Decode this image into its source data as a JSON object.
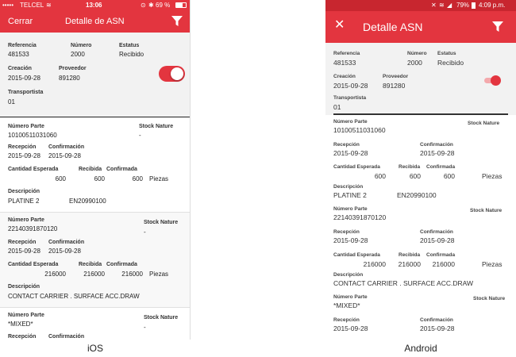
{
  "ios": {
    "status": {
      "carrier": "TELCEL",
      "time": "13:06",
      "battery": "69 %"
    },
    "nav": {
      "back": "Cerrar",
      "title": "Detalle de ASN"
    },
    "header": {
      "referencia_label": "Referencia",
      "referencia": "481533",
      "numero_label": "Número",
      "numero": "2000",
      "estatus_label": "Estatus",
      "estatus": "Recibido",
      "creacion_label": "Creación",
      "creacion": "2015-09-28",
      "proveedor_label": "Proveedor",
      "proveedor": "891280",
      "transportista_label": "Transportista",
      "transportista": "01"
    },
    "items": [
      {
        "np_label": "Número Parte",
        "np": "10100511031060",
        "sn_label": "Stock Nature",
        "sn": "-",
        "rec_label": "Recepción",
        "rec": "2015-09-28",
        "conf_label": "Confirmación",
        "conf": "2015-09-28",
        "ce_label": "Cantidad Esperada",
        "ce": "600",
        "rcb_label": "Recibida",
        "rcb": "600",
        "cf_label": "Confirmada",
        "cf": "600",
        "unit": "Piezas",
        "desc_label": "Descripción",
        "desc": "PLATINE 2",
        "desc2": "EN20990100"
      },
      {
        "np_label": "Número Parte",
        "np": "22140391870120",
        "sn_label": "Stock Nature",
        "sn": "-",
        "rec_label": "Recepción",
        "rec": "2015-09-28",
        "conf_label": "Confirmación",
        "conf": "2015-09-28",
        "ce_label": "Cantidad Esperada",
        "ce": "216000",
        "rcb_label": "Recibida",
        "rcb": "216000",
        "cf_label": "Confirmada",
        "cf": "216000",
        "unit": "Piezas",
        "desc_label": "Descripción",
        "desc": "CONTACT CARRIER . SURFACE ACC.DRAW"
      },
      {
        "np_label": "Número Parte",
        "np": "*MIXED*",
        "sn_label": "Stock Nature",
        "sn": "-",
        "rec_label": "Recepción",
        "conf_label": "Confirmación"
      }
    ],
    "caption": "iOS"
  },
  "android": {
    "status": {
      "battery": "79%",
      "time": "4:09 p.m."
    },
    "nav": {
      "title": "Detalle ASN"
    },
    "header": {
      "referencia_label": "Referencia",
      "referencia": "481533",
      "numero_label": "Número",
      "numero": "2000",
      "estatus_label": "Estatus",
      "estatus": "Recibido",
      "creacion_label": "Creación",
      "creacion": "2015-09-28",
      "proveedor_label": "Proveedor",
      "proveedor": "891280",
      "transportista_label": "Transportista",
      "transportista": "01"
    },
    "items": [
      {
        "np_label": "Número Parte",
        "np": "10100511031060",
        "sn_label": "Stock Nature",
        "rec_label": "Recepción",
        "rec": "2015-09-28",
        "conf_label": "Confirmación",
        "conf": "2015-09-28",
        "ce_label": "Cantidad Esperada",
        "ce": "600",
        "rcb_label": "Recibida",
        "rcb": "600",
        "cf_label": "Confirmada",
        "cf": "600",
        "unit": "Piezas",
        "desc_label": "Descripción",
        "desc": "PLATINE 2",
        "desc2": "EN20990100"
      },
      {
        "np_label": "Número Parte",
        "np": "22140391870120",
        "sn_label": "Stock Nature",
        "rec_label": "Recepción",
        "rec": "2015-09-28",
        "conf_label": "Confirmación",
        "conf": "2015-09-28",
        "ce_label": "Cantidad Esperada",
        "ce": "216000",
        "rcb_label": "Recibida",
        "rcb": "216000",
        "cf_label": "Confirmada",
        "cf": "216000",
        "unit": "Piezas",
        "desc_label": "Descripción",
        "desc": "CONTACT CARRIER . SURFACE ACC.DRAW"
      },
      {
        "np_label": "Número Parte",
        "np": "*MIXED*",
        "sn_label": "Stock Nature",
        "rec_label": "Recepción",
        "rec": "2015-09-28",
        "conf_label": "Confirmación",
        "conf": "2015-09-28"
      }
    ],
    "caption": "Android"
  },
  "colors": {
    "accent": "#e3353f"
  }
}
